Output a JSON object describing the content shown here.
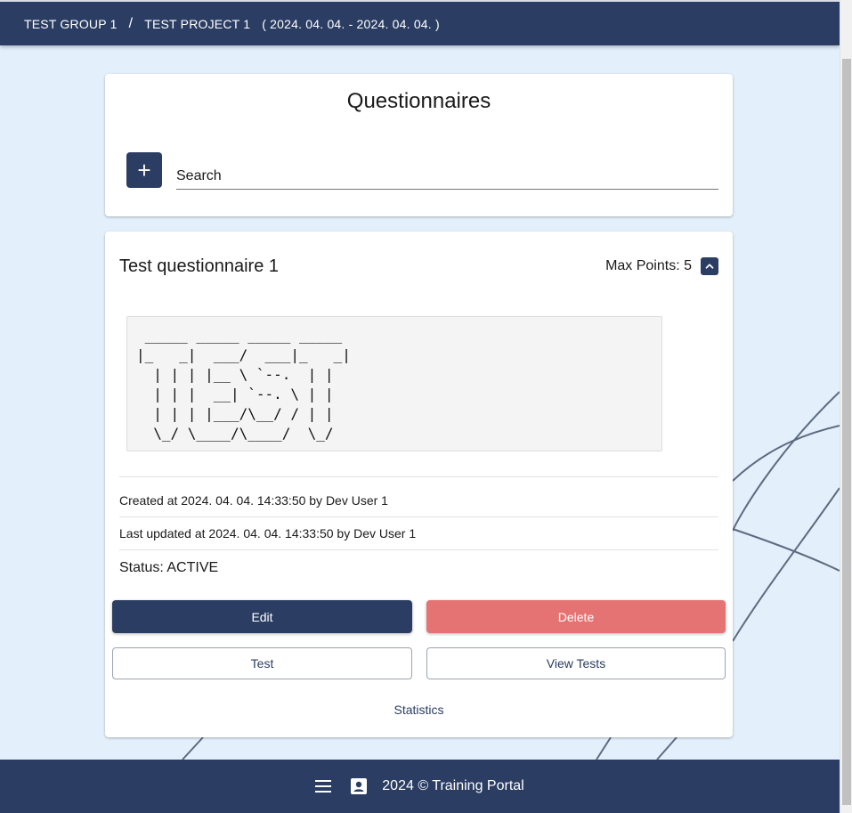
{
  "header": {
    "group": "TEST GROUP 1",
    "separator": "/",
    "project": "TEST PROJECT 1",
    "dates": "( 2024. 04. 04. - 2024. 04. 04. )"
  },
  "search_card": {
    "title": "Questionnaires",
    "add_label": "+",
    "search_placeholder": "Search"
  },
  "questionnaire": {
    "title": "Test questionnaire 1",
    "max_points": "Max Points: 5",
    "ascii_art": " _____ _____ _____ _____ \n|_   _|  ___/  ___|_   _|\n  | | | |__ \\ `--.  | |  \n  | | |  __| `--. \\ | |  \n  | | | |___/\\__/ / | |  \n  \\_/ \\____/\\____/  \\_/  ",
    "created": "Created at 2024. 04. 04. 14:33:50 by Dev User 1",
    "updated": "Last updated at 2024. 04. 04. 14:33:50 by Dev User 1",
    "status": "Status: ACTIVE",
    "buttons": {
      "edit": "Edit",
      "delete": "Delete",
      "test": "Test",
      "view_tests": "View Tests",
      "statistics": "Statistics"
    }
  },
  "footer": {
    "text": "2024 © Training Portal",
    "icons": [
      "menu-icon",
      "contact-card-icon"
    ]
  },
  "colors": {
    "primary": "#2b3d63",
    "danger": "#e57373",
    "background": "#e3f0fb"
  }
}
